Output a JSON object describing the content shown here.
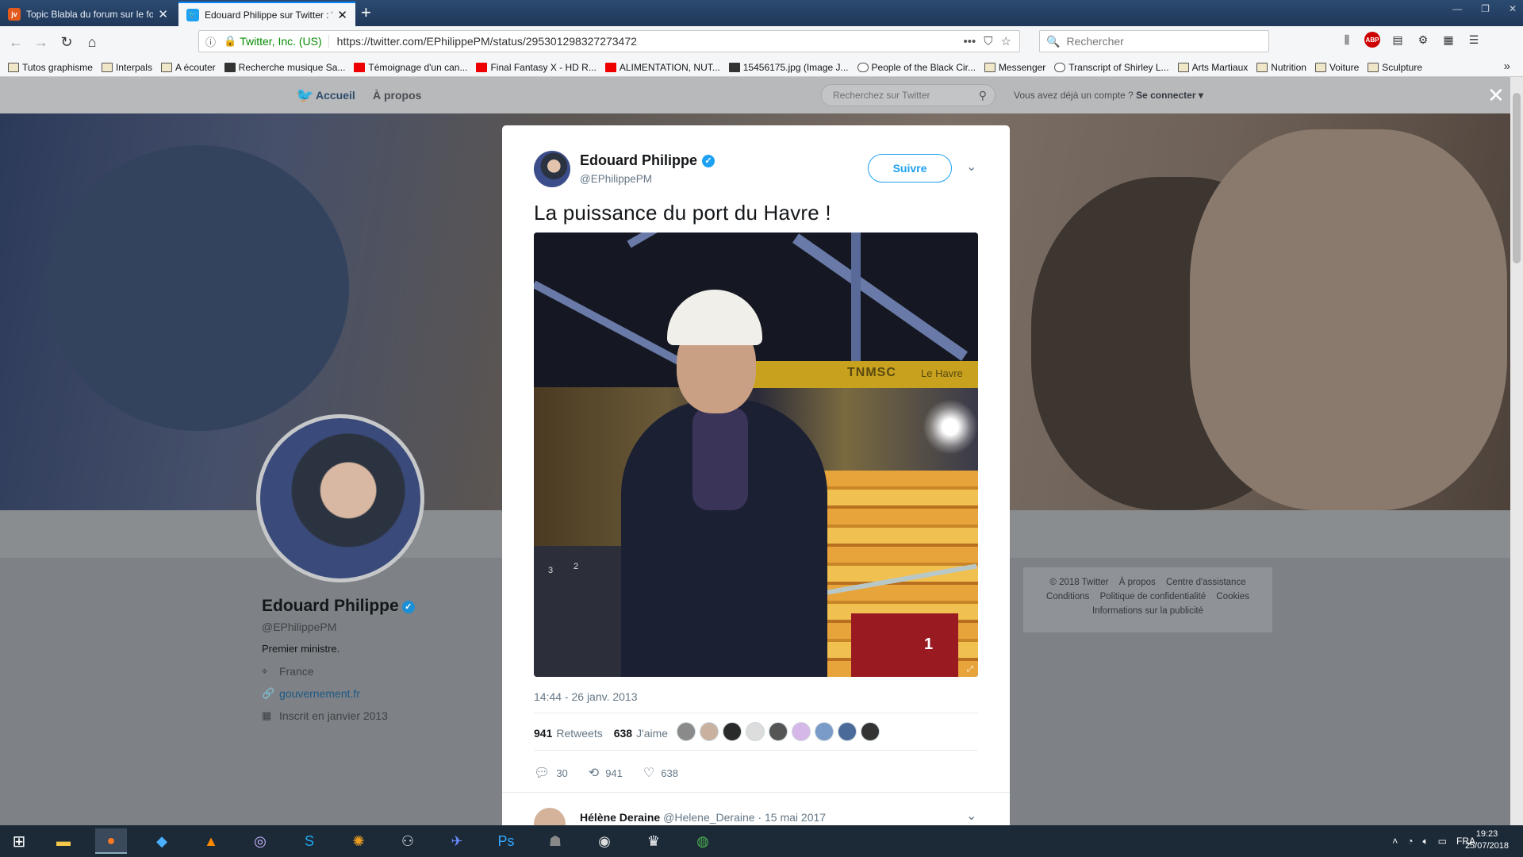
{
  "browser": {
    "tabs": [
      {
        "title": "Topic Blabla du forum sur le fo",
        "favicon": "jvc-favicon",
        "active": false
      },
      {
        "title": "Edouard Philippe sur Twitter : \"",
        "favicon": "twitter-favicon",
        "active": true
      }
    ],
    "url_org": "Twitter, Inc. (US)",
    "url": "https://twitter.com/EPhilippePM/status/295301298327273472",
    "search_placeholder": "Rechercher",
    "bookmarks": [
      {
        "label": "Tutos graphisme",
        "icon": "folder-icon"
      },
      {
        "label": "Interpals",
        "icon": "folder-icon"
      },
      {
        "label": "A écouter",
        "icon": "folder-icon"
      },
      {
        "label": "Recherche musique Sa...",
        "icon": "rym-icon"
      },
      {
        "label": "Témoignage d'un can...",
        "icon": "youtube-icon"
      },
      {
        "label": "Final Fantasy X - HD R...",
        "icon": "youtube-icon"
      },
      {
        "label": "ALIMENTATION, NUT...",
        "icon": "jvc-icon"
      },
      {
        "label": "15456175.jpg (Image J...",
        "icon": "image-icon"
      },
      {
        "label": "People of the Black Cir...",
        "icon": "person-icon"
      },
      {
        "label": "Messenger",
        "icon": "folder-icon"
      },
      {
        "label": "Transcript of Shirley L...",
        "icon": "globe-icon"
      },
      {
        "label": "Arts Martiaux",
        "icon": "folder-icon"
      },
      {
        "label": "Nutrition",
        "icon": "folder-icon"
      },
      {
        "label": "Voiture",
        "icon": "folder-icon"
      },
      {
        "label": "Sculpture",
        "icon": "folder-icon"
      }
    ]
  },
  "twitter_nav": {
    "home": "Accueil",
    "about": "À propos",
    "search_placeholder": "Recherchez sur Twitter",
    "account_prompt": "Vous avez déjà un compte ?",
    "login": "Se connecter"
  },
  "profile": {
    "name": "Edouard Philippe",
    "handle": "@EPhilippePM",
    "bio": "Premier ministre.",
    "location": "France",
    "website": "gouvernement.fr",
    "joined": "Inscrit en janvier 2013"
  },
  "footer": {
    "links": [
      "© 2018 Twitter",
      "À propos",
      "Centre d'assistance",
      "Conditions",
      "Politique de confidentialité",
      "Cookies",
      "Informations sur la publicité"
    ]
  },
  "tweet": {
    "name": "Edouard Philippe",
    "handle": "@EPhilippePM",
    "follow_label": "Suivre",
    "text": "La puissance du port du Havre !",
    "photo_text": "TNMSC",
    "photo_text2": "Le Havre",
    "timestamp": "14:44 - 26 janv. 2013",
    "retweets": "941",
    "retweets_label": "Retweets",
    "likes": "638",
    "likes_label": "J'aime",
    "reply_count": "30",
    "retweet_count": "941",
    "like_count": "638"
  },
  "reply": {
    "name": "Hélène Deraine",
    "handle": "@Helene_Deraine",
    "date": "· 15 mai 2017"
  },
  "taskbar": {
    "lang": "FRA",
    "time": "19:23",
    "date": "25/07/2018"
  },
  "colors": {
    "twitter_blue": "#1da1f2",
    "verified": "#1da1f2",
    "overlay": "#7e8185"
  }
}
